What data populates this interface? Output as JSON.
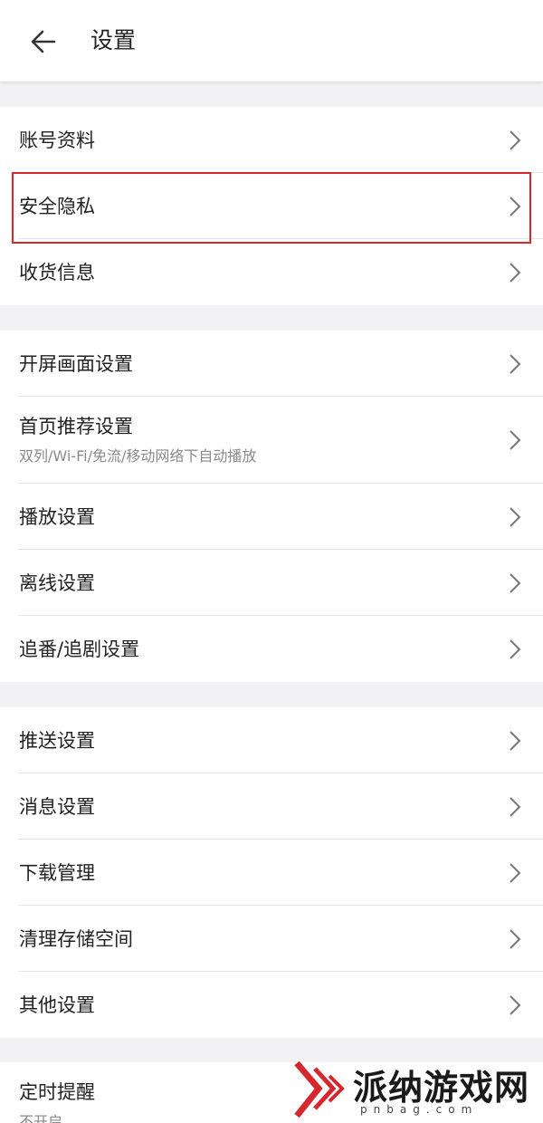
{
  "header": {
    "title": "设置"
  },
  "groups": [
    {
      "items": [
        {
          "label": "账号资料"
        },
        {
          "label": "安全隐私",
          "highlighted": true
        },
        {
          "label": "收货信息"
        }
      ]
    },
    {
      "items": [
        {
          "label": "开屏画面设置"
        },
        {
          "label": "首页推荐设置",
          "subtitle": "双列/Wi-Fi/免流/移动网络下自动播放"
        },
        {
          "label": "播放设置"
        },
        {
          "label": "离线设置"
        },
        {
          "label": "追番/追剧设置"
        }
      ]
    },
    {
      "items": [
        {
          "label": "推送设置"
        },
        {
          "label": "消息设置"
        },
        {
          "label": "下载管理"
        },
        {
          "label": "清理存储空间"
        },
        {
          "label": "其他设置"
        }
      ]
    },
    {
      "items": [
        {
          "label": "定时提醒",
          "subtitle": "不开启"
        }
      ]
    }
  ],
  "watermark": {
    "text": "派纳游戏网",
    "url": "pnbag.com"
  },
  "colors": {
    "highlight": "#d6262e",
    "background": "#f2f2f4"
  }
}
